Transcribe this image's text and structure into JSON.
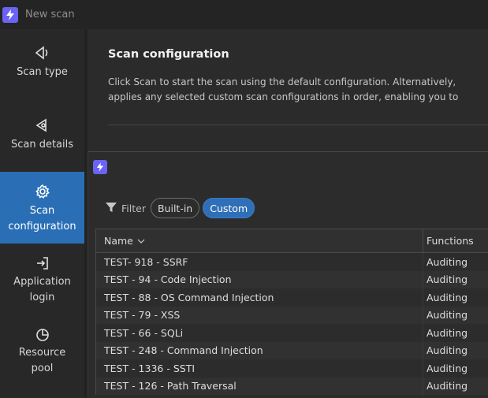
{
  "window": {
    "title": "New scan"
  },
  "sidebar": {
    "items": [
      {
        "label": "Scan type",
        "icon": "scan-type-icon"
      },
      {
        "label": "Scan details",
        "icon": "scan-details-icon"
      },
      {
        "label": "Scan configuration",
        "icon": "gear-icon",
        "active": true
      },
      {
        "label": "Application login",
        "icon": "login-icon"
      },
      {
        "label": "Resource pool",
        "icon": "resource-pool-icon"
      }
    ]
  },
  "main": {
    "title": "Scan configuration",
    "desc_line1": "Click Scan to start the scan using the default configuration. Alternatively,",
    "desc_line2": "applies any selected custom scan configurations in order, enabling you to"
  },
  "dialog": {
    "filter_label": "Filter",
    "chips": {
      "builtin": "Built-in",
      "custom": "Custom",
      "selected": "Custom"
    },
    "table": {
      "columns": {
        "name": "Name",
        "functions": "Functions"
      },
      "rows": [
        {
          "name": "TEST- 918 - SSRF",
          "functions": "Auditing"
        },
        {
          "name": "TEST - 94 - Code Injection",
          "functions": "Auditing"
        },
        {
          "name": "TEST - 88 - OS Command Injection",
          "functions": "Auditing"
        },
        {
          "name": "TEST - 79 - XSS",
          "functions": "Auditing"
        },
        {
          "name": "TEST - 66 - SQLi",
          "functions": "Auditing"
        },
        {
          "name": "TEST - 248 - Command Injection",
          "functions": "Auditing"
        },
        {
          "name": "TEST - 1336 - SSTI",
          "functions": "Auditing"
        },
        {
          "name": "TEST - 126 - Path Traversal",
          "functions": "Auditing"
        }
      ]
    }
  },
  "colors": {
    "accent": "#2a6fb5",
    "logo": "#6b63f3",
    "background": "#2b2b2b"
  }
}
